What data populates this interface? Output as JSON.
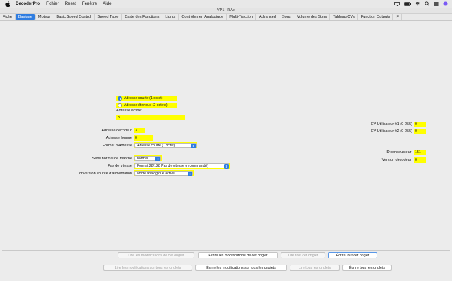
{
  "menubar": {
    "app": "DecoderPro",
    "items": [
      "Fichier",
      "Reset",
      "Fenêtre",
      "Aide"
    ]
  },
  "window": {
    "title": "VP1 - RAe"
  },
  "tabs": [
    "Fiche",
    "Basique",
    "Moteur",
    "Basic Speed Control",
    "Speed Table",
    "Carte des Fonctions",
    "Lights",
    "Contrôles en Analogique",
    "Multi-Traction",
    "Advanced",
    "Sons",
    "Volume des Sons",
    "Tableau CVs",
    "Function Outputs",
    "F"
  ],
  "active_tab": "Basique",
  "address": {
    "short_label": "Adresse courte (1 octet)",
    "extended_label": "Adresse étendue (2 octets)",
    "active_label": "Adresse active:",
    "active_value": "3"
  },
  "fields": {
    "decoder_address_label": "Adresse décodeur",
    "decoder_address_value": "3",
    "long_address_label": "Adresse longue",
    "long_address_value": "0",
    "address_format_label": "Format d'Adresse",
    "address_format_value": "Adresse courte (1 octet)",
    "direction_label": "Sens normal de marche",
    "direction_value": "normal",
    "speed_step_label": "Pas de vitesse",
    "speed_step_value": "Format 28/128 Pas de vitesse (recommandé)",
    "power_source_label": "Conversion source d'alimentation",
    "power_source_value": "Mode analogique activé"
  },
  "right": {
    "cv_user1_label": "CV Utilisateur #1 (0-255)",
    "cv_user1_value": "0",
    "cv_user2_label": "CV Utilisateur #2 (0-255)",
    "cv_user2_value": "0",
    "manufacturer_label": "ID constructeur:",
    "manufacturer_value": "151",
    "version_label": "Version décodeur:",
    "version_value": "0"
  },
  "buttons": {
    "read_changes_tab": "Lire les modifications de cet onglet",
    "write_changes_tab": "Écrire les modifications de cet onglet",
    "read_all_tab": "Lire tout cet onglet",
    "write_all_tab": "Écrire tout cet onglet",
    "read_changes_all": "Lire les modifications sur tous les onglets",
    "write_changes_all": "Écrire les modifications sur tous les onglets",
    "read_all": "Lire tous les onglets",
    "write_all": "Écrire tous les onglets"
  },
  "colors": {
    "accent": "#2f7de1",
    "highlight": "#ffff00"
  }
}
